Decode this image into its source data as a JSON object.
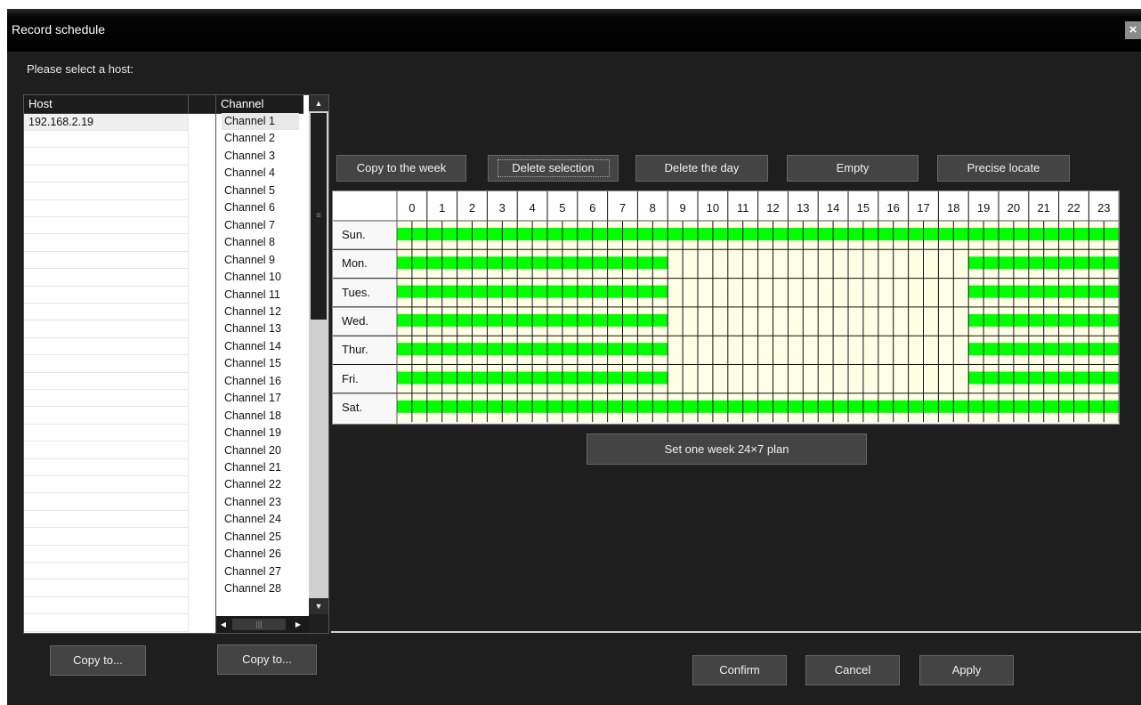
{
  "dialog": {
    "title": "Record schedule",
    "close_icon": "close-icon"
  },
  "prompt": "Please select a host:",
  "hosts": {
    "header": "Host",
    "items": [
      "192.168.2.19"
    ]
  },
  "channels": {
    "header": "Channel",
    "items": [
      "Channel 1",
      "Channel 2",
      "Channel 3",
      "Channel 4",
      "Channel 5",
      "Channel 6",
      "Channel 7",
      "Channel 8",
      "Channel 9",
      "Channel 10",
      "Channel 11",
      "Channel 12",
      "Channel 13",
      "Channel 14",
      "Channel 15",
      "Channel 16",
      "Channel 17",
      "Channel 18",
      "Channel 19",
      "Channel 20",
      "Channel 21",
      "Channel 22",
      "Channel 23",
      "Channel 24",
      "Channel 25",
      "Channel 26",
      "Channel 27",
      "Channel 28"
    ],
    "scroll_up_icon": "triangle-up-icon",
    "scroll_down_icon": "triangle-down-icon"
  },
  "toolbar": {
    "copy_week": "Copy to the week",
    "delete_selection": "Delete selection",
    "delete_day": "Delete the day",
    "empty": "Empty",
    "precise_locate": "Precise locate"
  },
  "schedule": {
    "hours": [
      "0",
      "1",
      "2",
      "3",
      "4",
      "5",
      "6",
      "7",
      "8",
      "9",
      "10",
      "11",
      "12",
      "13",
      "14",
      "15",
      "16",
      "17",
      "18",
      "19",
      "20",
      "21",
      "22",
      "23"
    ],
    "days": [
      {
        "label": "Sun.",
        "recording": [
          [
            0,
            24
          ]
        ]
      },
      {
        "label": "Mon.",
        "recording": [
          [
            0,
            9
          ],
          [
            19,
            24
          ]
        ]
      },
      {
        "label": "Tues.",
        "recording": [
          [
            0,
            9
          ],
          [
            19,
            24
          ]
        ]
      },
      {
        "label": "Wed.",
        "recording": [
          [
            0,
            9
          ],
          [
            19,
            24
          ]
        ]
      },
      {
        "label": "Thur.",
        "recording": [
          [
            0,
            9
          ],
          [
            19,
            24
          ]
        ]
      },
      {
        "label": "Fri.",
        "recording": [
          [
            0,
            9
          ],
          [
            19,
            24
          ]
        ]
      },
      {
        "label": "Sat.",
        "recording": [
          [
            0,
            24
          ]
        ]
      }
    ],
    "colors": {
      "recording": "#00ff00",
      "idle": "#ffffe6",
      "grid_line": "#111111"
    }
  },
  "set_week_plan": "Set one week 24×7 plan",
  "footer": {
    "host_copy": "Copy to...",
    "channel_copy": "Copy to...",
    "confirm": "Confirm",
    "cancel": "Cancel",
    "apply": "Apply"
  }
}
